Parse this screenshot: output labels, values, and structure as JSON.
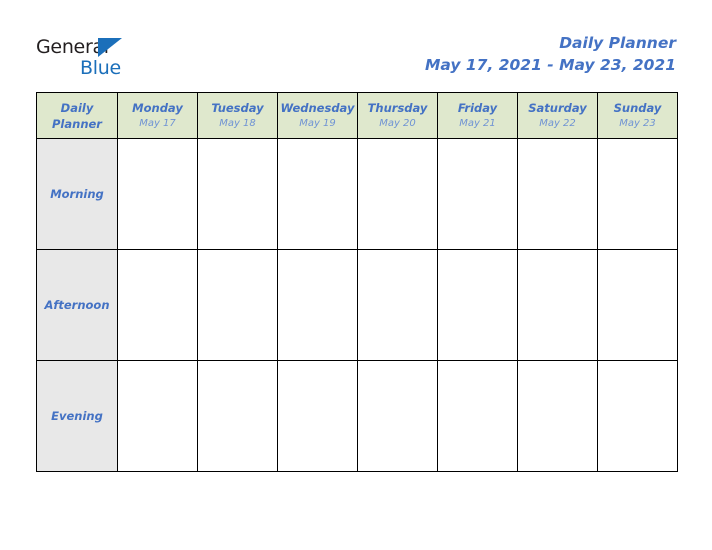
{
  "brand": {
    "name_dark": "General",
    "name_blue": "Blue",
    "triangle_color": "#1b6fba",
    "dark_color": "#231f20"
  },
  "header": {
    "title": "Daily Planner",
    "date_range": "May 17, 2021 - May 23, 2021",
    "accent_color": "#4472c4"
  },
  "table": {
    "corner": {
      "line1": "Daily",
      "line2": "Planner"
    },
    "header_bg": "#dfe8cd",
    "label_bg": "#e8e8e8",
    "border_color": "#000000",
    "days": [
      {
        "name": "Monday",
        "date": "May 17"
      },
      {
        "name": "Tuesday",
        "date": "May 18"
      },
      {
        "name": "Wednesday",
        "date": "May 19"
      },
      {
        "name": "Thursday",
        "date": "May 20"
      },
      {
        "name": "Friday",
        "date": "May 21"
      },
      {
        "name": "Saturday",
        "date": "May 22"
      },
      {
        "name": "Sunday",
        "date": "May 23"
      }
    ],
    "periods": [
      {
        "label": "Morning",
        "entries": [
          "",
          "",
          "",
          "",
          "",
          "",
          ""
        ]
      },
      {
        "label": "Afternoon",
        "entries": [
          "",
          "",
          "",
          "",
          "",
          "",
          ""
        ]
      },
      {
        "label": "Evening",
        "entries": [
          "",
          "",
          "",
          "",
          "",
          "",
          ""
        ]
      }
    ]
  }
}
